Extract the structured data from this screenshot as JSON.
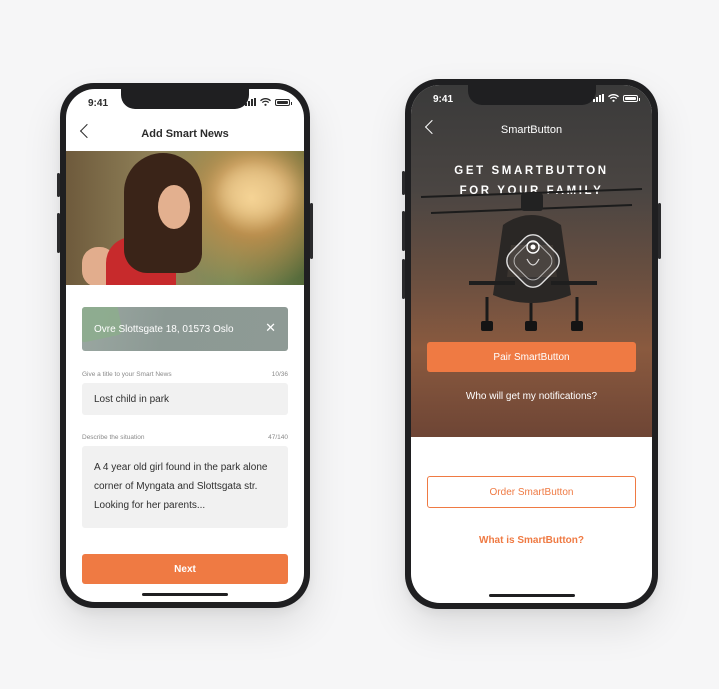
{
  "colors": {
    "accent": "#ef7a43",
    "phone_frame": "#1f1f21",
    "field_bg": "#f1f1f1"
  },
  "left_phone": {
    "status_time": "9:41",
    "nav_title": "Add Smart News",
    "address": "Ovre Slottsgate 18, 01573 Oslo",
    "title_field": {
      "label": "Give a title to your Smart News",
      "counter": "10/36",
      "value": "Lost child in park"
    },
    "description_field": {
      "label": "Describe the situation",
      "counter": "47/140",
      "lines": [
        "A 4 year old girl found in the park alone",
        "corner of Myngata and Slottsgata str.",
        "Looking for her parents..."
      ]
    },
    "next_label": "Next",
    "icons": {
      "back": "chevron-left-icon",
      "clear": "close-icon"
    }
  },
  "right_phone": {
    "status_time": "9:41",
    "nav_title": "SmartButton",
    "headline": [
      "GET SMARTBUTTON",
      "FOR YOUR FAMILY"
    ],
    "pair_label": "Pair SmartButton",
    "who_label": "Who will get my notifications?",
    "order_label": "Order SmartButton",
    "what_label": "What is SmartButton?"
  }
}
